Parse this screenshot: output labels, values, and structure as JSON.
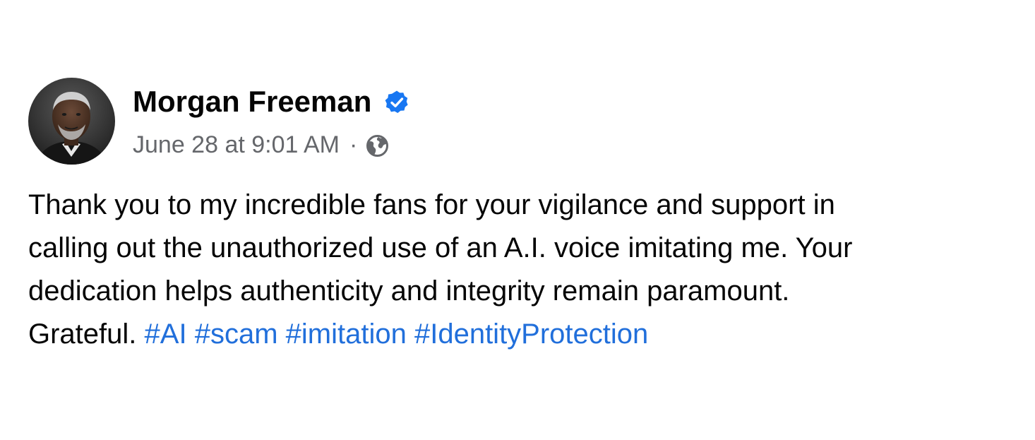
{
  "post": {
    "author_name": "Morgan Freeman",
    "verified": true,
    "timestamp": "June 28 at 9:01 AM",
    "separator": "·",
    "audience_icon": "globe-icon",
    "body_lines": [
      "Thank you to my incredible fans for your vigilance and support in",
      "calling out the unauthorized use of an A.I. voice imitating me. Your",
      "dedication helps authenticity and integrity remain paramount.",
      "Grateful."
    ],
    "hashtags": [
      "#AI",
      "#scam",
      "#imitation",
      "#IdentityProtection"
    ]
  },
  "colors": {
    "text": "#050505",
    "secondary": "#65676b",
    "link": "#216fdb",
    "verified_badge": "#1877f2"
  }
}
